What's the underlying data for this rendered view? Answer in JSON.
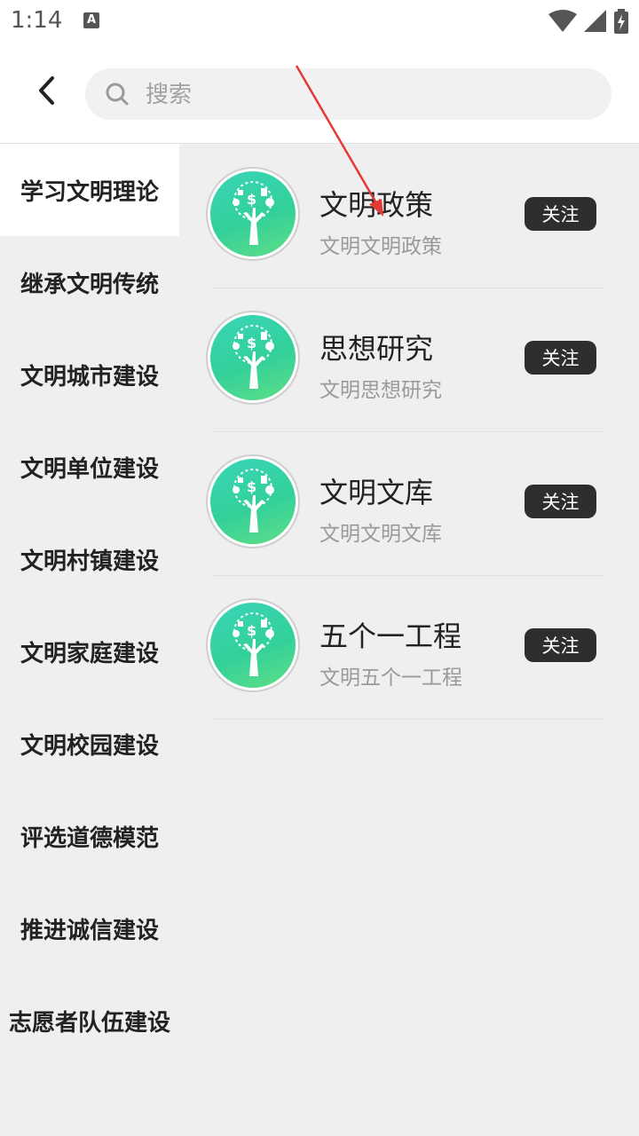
{
  "status_bar": {
    "time": "1:14",
    "notification_icon": "a-icon",
    "icons": [
      "wifi-icon",
      "signal-icon",
      "battery-charging-icon"
    ]
  },
  "header": {
    "back_icon": "chevron-left-icon",
    "search": {
      "icon": "search-icon",
      "placeholder": "搜索",
      "value": ""
    }
  },
  "sidebar": {
    "items": [
      {
        "label": "学习文明理论",
        "active": true
      },
      {
        "label": "继承文明传统",
        "active": false
      },
      {
        "label": "文明城市建设",
        "active": false
      },
      {
        "label": "文明单位建设",
        "active": false
      },
      {
        "label": "文明村镇建设",
        "active": false
      },
      {
        "label": "文明家庭建设",
        "active": false
      },
      {
        "label": "文明校园建设",
        "active": false
      },
      {
        "label": "评选道德模范",
        "active": false
      },
      {
        "label": "推进诚信建设",
        "active": false
      },
      {
        "label": "志愿者队伍建设",
        "active": false
      }
    ]
  },
  "content": {
    "items": [
      {
        "title": "文明政策",
        "subtitle": "文明文明政策",
        "button": "关注",
        "avatar_icon": "money-tree-icon"
      },
      {
        "title": "思想研究",
        "subtitle": "文明思想研究",
        "button": "关注",
        "avatar_icon": "money-tree-icon"
      },
      {
        "title": "文明文库",
        "subtitle": "文明文明文库",
        "button": "关注",
        "avatar_icon": "money-tree-icon"
      },
      {
        "title": "五个一工程",
        "subtitle": "文明五个一工程",
        "button": "关注",
        "avatar_icon": "money-tree-icon"
      }
    ]
  },
  "colors": {
    "follow_button_bg": "#2e2e2e",
    "avatar_green": "#33d09a",
    "annotation_arrow": "#e53935"
  }
}
